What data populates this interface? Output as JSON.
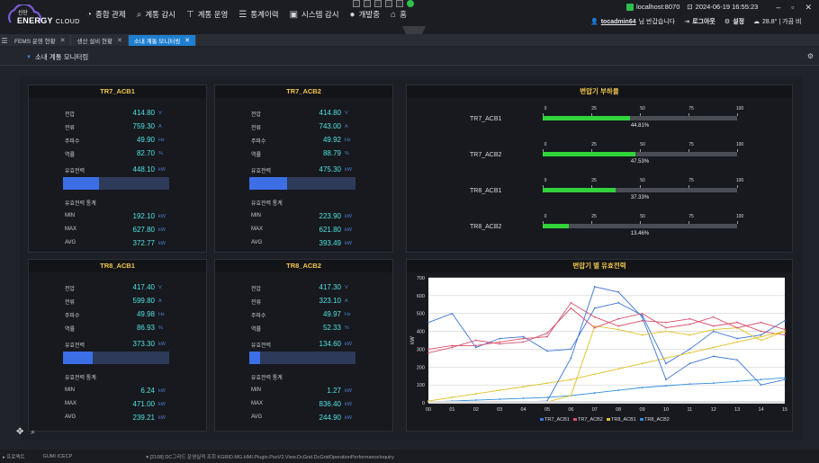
{
  "app": {
    "logo_top": "신단",
    "logo_main": "ENERGY",
    "logo_sub": "CLOUD"
  },
  "menu": [
    {
      "label": "종합 관제",
      "icon": "dashboard-icon"
    },
    {
      "label": "계통 감시",
      "icon": "search-icon"
    },
    {
      "label": "계통 운영",
      "icon": "hierarchy-icon"
    },
    {
      "label": "통계이력",
      "icon": "list-icon"
    },
    {
      "label": "시스템 감시",
      "icon": "monitor-icon"
    },
    {
      "label": "개발중",
      "icon": "user-icon"
    },
    {
      "label": "홈",
      "icon": "home-icon"
    }
  ],
  "top": {
    "host": "localhost:8070",
    "datetime": "2024-06-19 16:55:23",
    "user": "tocadmin64",
    "greeting": "님 반갑습니다",
    "logout": "로그아웃",
    "settings": "설정",
    "weather": "28.8° | 가끔 비"
  },
  "tabs": [
    {
      "label": "FEMS 운영 현황",
      "active": false
    },
    {
      "label": "생산 설비 현황",
      "active": false
    },
    {
      "label": "소내 계통 모니터링",
      "active": true
    }
  ],
  "page_title": "소내 계통 모니터링",
  "labels": {
    "voltage": "전압",
    "current": "전류",
    "freq": "주파수",
    "pf": "역률",
    "active": "유효전력",
    "stats": "유효전력 통계",
    "min": "MIN",
    "max": "MAX",
    "avg": "AVG",
    "u_v": "V",
    "u_a": "A",
    "u_hz": "Hz",
    "u_pct": "%",
    "u_kw": "kW"
  },
  "acb": [
    {
      "name": "TR7_ACB1",
      "voltage": "414.80",
      "current": "759.30",
      "freq": "49.90",
      "pf": "82.70",
      "active": "448.10",
      "fill": 0.34,
      "min": "192.10",
      "max": "627.80",
      "avg": "372.77"
    },
    {
      "name": "TR7_ACB2",
      "voltage": "414.80",
      "current": "743.00",
      "freq": "49.92",
      "pf": "88.79",
      "active": "475.30",
      "fill": 0.36,
      "min": "223.90",
      "max": "621.80",
      "avg": "393.49"
    },
    {
      "name": "TR8_ACB1",
      "voltage": "417.40",
      "current": "599.80",
      "freq": "49.98",
      "pf": "86.93",
      "active": "373.30",
      "fill": 0.28,
      "min": "6.24",
      "max": "471.00",
      "avg": "239.21"
    },
    {
      "name": "TR8_ACB2",
      "voltage": "417.30",
      "current": "323.10",
      "freq": "49.97",
      "pf": "52.33",
      "active": "134.60",
      "fill": 0.1,
      "min": "1.27",
      "max": "836.40",
      "avg": "244.90"
    }
  ],
  "load": {
    "title": "변압기 부하율",
    "ticks": [
      "0",
      "25",
      "50",
      "75",
      "100"
    ],
    "items": [
      {
        "name": "TR7_ACB1",
        "value": 44.81,
        "label": "44.81%"
      },
      {
        "name": "TR7_ACB2",
        "value": 47.53,
        "label": "47.53%"
      },
      {
        "name": "TR8_ACB1",
        "value": 37.33,
        "label": "37.33%"
      },
      {
        "name": "TR8_ACB2",
        "value": 13.46,
        "label": "13.46%"
      }
    ]
  },
  "chart_data": {
    "type": "line",
    "title": "변압기 별 유효전력",
    "ylabel": "kW",
    "ylim": [
      0,
      700
    ],
    "yticks": [
      "0",
      "100",
      "200",
      "300",
      "400",
      "500",
      "600",
      "700"
    ],
    "categories": [
      "00",
      "01",
      "02",
      "03",
      "04",
      "05",
      "06",
      "07",
      "08",
      "09",
      "10",
      "11",
      "12",
      "13",
      "14",
      "15"
    ],
    "series": [
      {
        "name": "TR7_ACB1",
        "color": "#3c74d8",
        "values": [
          450,
          500,
          310,
          360,
          370,
          290,
          300,
          530,
          560,
          490,
          220,
          300,
          400,
          360,
          380,
          460
        ]
      },
      {
        "name": "TR7_ACB2",
        "color": "#d8506c",
        "values": [
          300,
          320,
          320,
          340,
          360,
          370,
          560,
          480,
          430,
          460,
          450,
          470,
          430,
          450,
          400,
          380
        ]
      },
      {
        "name": "TR8_ACB1",
        "color": "#e0c020",
        "values": [
          10,
          30,
          50,
          70,
          90,
          110,
          130,
          160,
          190,
          220,
          250,
          280,
          310,
          340,
          370,
          400
        ]
      },
      {
        "name": "TR8_ACB2",
        "color": "#2f8fe0",
        "values": [
          5,
          10,
          15,
          20,
          25,
          30,
          40,
          55,
          70,
          85,
          95,
          105,
          110,
          120,
          130,
          140
        ]
      }
    ],
    "extra_series": [
      {
        "color": "#3c74d8",
        "values": [
          5,
          5,
          5,
          5,
          5,
          10,
          250,
          650,
          620,
          480,
          130,
          220,
          260,
          240,
          100,
          130
        ]
      },
      {
        "color": "#e0c020",
        "values": [
          5,
          5,
          5,
          5,
          5,
          5,
          40,
          430,
          410,
          380,
          400,
          380,
          410,
          420,
          350,
          400
        ]
      },
      {
        "color": "#d8506c",
        "values": [
          280,
          310,
          350,
          330,
          340,
          390,
          530,
          420,
          470,
          500,
          420,
          440,
          480,
          420,
          450,
          410
        ]
      }
    ],
    "legend": "bottom"
  },
  "status": {
    "left1": "프로젝트",
    "left2": "GUMI ICECP",
    "msg": "[2108] DC그리드 운영실적 조회 KGRID.MG.HMI.Plugin.PsoV2.View.DcGrid.DcGridOperationPerformanceInquiry"
  }
}
